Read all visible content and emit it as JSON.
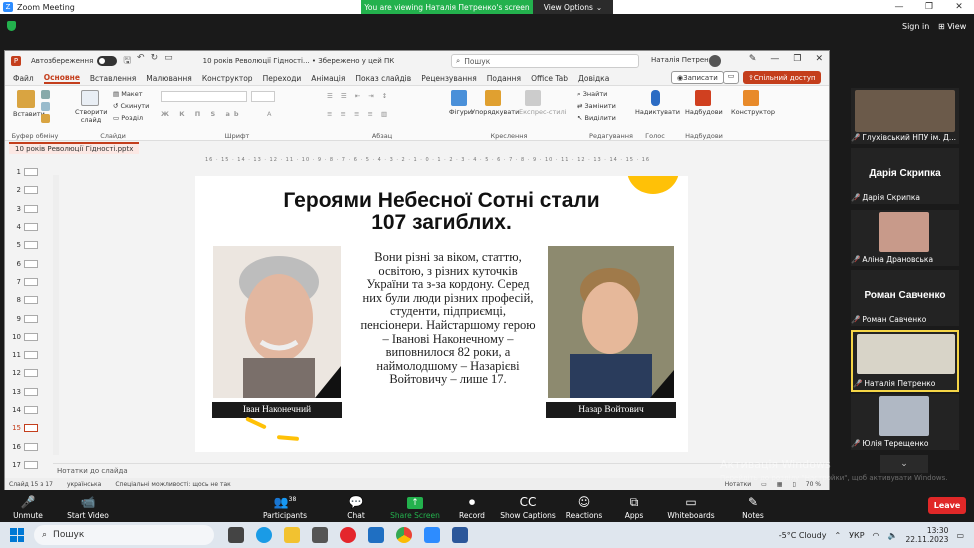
{
  "zoom": {
    "window_title": "Zoom Meeting",
    "viewing_banner": "You are viewing Наталія Петренко's screen",
    "view_options": "View Options",
    "sign_in": "Sign in",
    "view": "View",
    "toolbar": [
      {
        "label": "Unmute",
        "icon": "mic-off-icon"
      },
      {
        "label": "Start Video",
        "icon": "video-off-icon"
      },
      {
        "label": "Participants",
        "icon": "participants-icon",
        "count": "38"
      },
      {
        "label": "Chat",
        "icon": "chat-icon"
      },
      {
        "label": "Share Screen",
        "icon": "share-screen-icon"
      },
      {
        "label": "Record",
        "icon": "record-icon"
      },
      {
        "label": "Show Captions",
        "icon": "captions-icon"
      },
      {
        "label": "Reactions",
        "icon": "reactions-icon"
      },
      {
        "label": "Apps",
        "icon": "apps-icon"
      },
      {
        "label": "Whiteboards",
        "icon": "whiteboards-icon"
      },
      {
        "label": "Notes",
        "icon": "notes-icon"
      }
    ],
    "leave": "Leave",
    "participants": [
      {
        "name": "Глухівський НПУ ім. Д...",
        "big": ""
      },
      {
        "name": "Дарія Скрипка",
        "big": "Дарія Скрипка"
      },
      {
        "name": "Аліна Драновська",
        "big": ""
      },
      {
        "name": "Роман Савченко",
        "big": "Роман Савченко"
      },
      {
        "name": "Наталія Петренко",
        "big": ""
      },
      {
        "name": "Юлія Терещенко",
        "big": ""
      }
    ]
  },
  "ppt": {
    "autosave": "Автозбереження",
    "file_title": "10 років Революції Гідності... • Збережено у цей ПК",
    "search": "Пошук",
    "user": "Наталія Петренко",
    "tabs": [
      "Файл",
      "Основне",
      "Вставлення",
      "Малювання",
      "Конструктор",
      "Переходи",
      "Анімація",
      "Показ слайдів",
      "Рецензування",
      "Подання",
      "Office Tab",
      "Довідка"
    ],
    "active_tab": "Основне",
    "record_btn": "Записати",
    "share_btn": "Спільний доступ",
    "ribbon": {
      "paste": "Вставити",
      "clipboard": "Буфер обміну",
      "new_slide": "Створити слайд",
      "layout": "Макет",
      "reset": "Скинути",
      "section": "Розділ",
      "slides": "Слайди",
      "font": "Шрифт",
      "paragraph": "Абзац",
      "shapes": "Фігури",
      "arrange": "Упорядкувати",
      "styles": "Експрес-стилі",
      "drawing": "Креслення",
      "find": "Знайти",
      "replace": "Замінити",
      "select": "Виділити",
      "editing": "Редагування",
      "dictate": "Надиктувати",
      "voice": "Голос",
      "designer": "Надбудови",
      "addins": "Надбудови",
      "konstr": "Конструктор"
    },
    "doc_tab": "10 років Революції Гідності.pptx",
    "slide_numbers": [
      "1",
      "2",
      "3",
      "4",
      "5",
      "6",
      "7",
      "8",
      "9",
      "10",
      "11",
      "12",
      "13",
      "14",
      "15",
      "16",
      "17"
    ],
    "selected_slide": "15",
    "ruler": "16 · 15 · 14 · 13 · 12 · 11 · 10 · 9 · 8 · 7 · 6 · 5 · 4 · 3 · 2 · 1 · 0 · 1 · 2 · 3 · 4 · 5 · 6 · 7 · 8 · 9 · 10 · 11 · 12 · 13 · 14 · 15 · 16",
    "notes_placeholder": "Нотатки до слайда",
    "status": {
      "slide": "Слайд 15 з 17",
      "lang": "українська",
      "accessibility": "Спеціальні можливості: щось не так",
      "notes": "Нотатки",
      "zoom": "70 %"
    }
  },
  "slide": {
    "title_line1": "Героями Небесної Сотні стали",
    "title_line2": "107 загиблих.",
    "body": "Вони різні за віком, статтю, освітою, з різних куточків України та з-за кордону. Серед них були люди різних професій, студенти, підприємці, пенсіонери. Найстаршому герою – Іванові Наконечному – виповнилося 82 роки, а наймолодшому – Назарієві Войтовичу – лише 17.",
    "caption_left": "Іван Наконечний",
    "caption_right": "Назар Войтович"
  },
  "windows": {
    "activation_title": "Активація Windows",
    "activation_sub": "Перейдіть до розділу \"Настройки\", щоб активувати Windows.",
    "search": "Пошук",
    "weather": "-5°C Cloudy",
    "lang": "УКР",
    "time": "13:30",
    "date": "22.11.2023"
  },
  "colors": {
    "ppt_accent": "#c43e1c",
    "zoom_green": "#23b14d",
    "zoom_leave": "#e02828",
    "slide_yellow": "#ffc107"
  }
}
